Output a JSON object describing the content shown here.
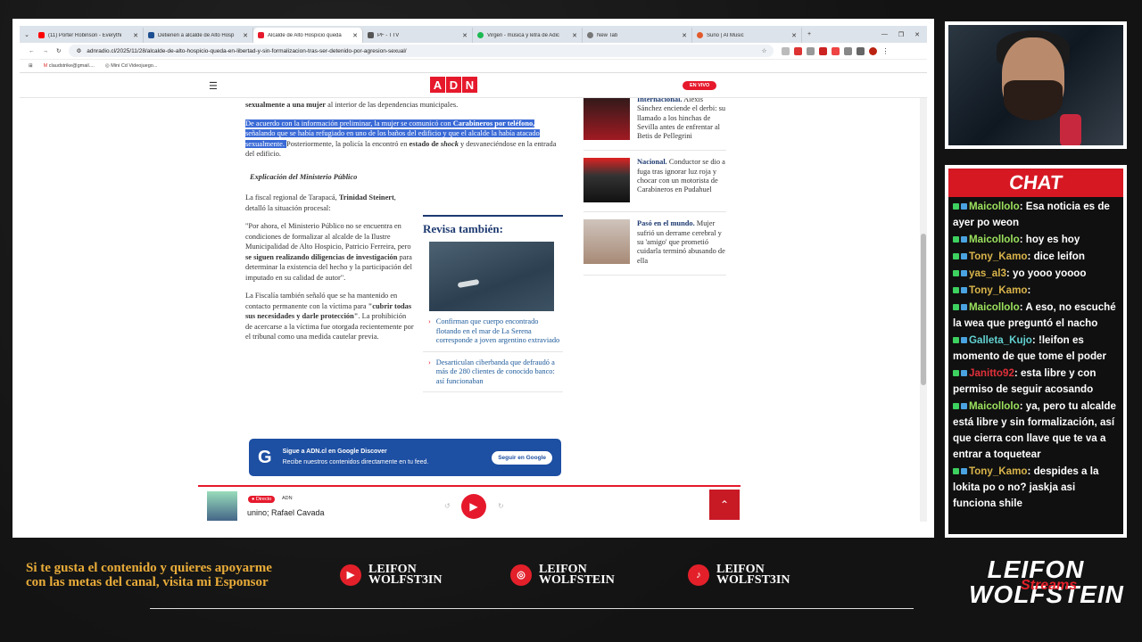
{
  "tabs": [
    {
      "title": "(11) Porter Robinson - Everythi",
      "color": "#ff0000",
      "active": false
    },
    {
      "title": "Detienen a alcalde de Alto Hosp",
      "color": "#1d4f91",
      "active": false
    },
    {
      "title": "Alcalde de Alto Hospicio queda",
      "color": "#e6192c",
      "active": true
    },
    {
      "title": "PF - TTV",
      "color": "#555555",
      "active": false
    },
    {
      "title": "Virgen - música y letra de Adic",
      "color": "#1db954",
      "active": false
    },
    {
      "title": "New Tab",
      "color": "#777777",
      "active": false
    },
    {
      "title": "Suno | AI Music",
      "color": "#e25b2c",
      "active": false
    }
  ],
  "url": "adnradio.cl/2025/11/28/alcalde-de-alto-hospicio-queda-en-libertad-y-sin-formalizacion-tras-ser-detenido-por-agresion-sexual/",
  "bookmarks": [
    "claudstrike@gmail....",
    "Mini Cd Videojuego..."
  ],
  "site": {
    "logo": [
      "A",
      "D",
      "N"
    ],
    "live": "EN VIVO"
  },
  "article": {
    "p0_bold": "sexualmente a una mujer",
    "p0_rest": " al interior de las dependencias municipales.",
    "p1_hl_a": "De acuerdo con la información preliminar, la mujer se comunicó con ",
    "p1_hl_b": "Carabineros por teléfono,",
    "p1_hl_c": " señalando que se había refugiado en uno de los baños del edificio y que el alcalde la había atacado sexualmente. ",
    "p1_rest_a": "Posteriormente, la policía la encontró en ",
    "p1_rest_b": "estado de ",
    "p1_rest_c": "shock",
    "p1_rest_d": " y desvaneciéndose en la entrada del edificio.",
    "subheading": "Explicación del Ministerio Público",
    "p2_a": "La fiscal regional de Tarapacá, ",
    "p2_b": "Trinidad Steinert",
    "p2_c": ", detalló la situación procesal:",
    "p3_a": "\"Por ahora, el Ministerio Público no se encuentra en condiciones de formalizar al alcalde de la Ilustre Municipalidad de Alto Hospicio, Patricio Ferreira, pero ",
    "p3_b": "se siguen realizando diligencias de investigación",
    "p3_c": " para determinar la existencia del hecho y la participación del imputado en su calidad de autor\".",
    "p4_a": "La Fiscalía también señaló que se ha mantenido en contacto permanente con la víctima para ",
    "p4_b": "\"cubrir todas sus necesidades y darle protección\"",
    "p4_c": ". La prohibición de acercarse a la víctima fue otorgada recientemente por el tribunal como una medida cautelar previa."
  },
  "revisa": {
    "title": "Revisa también:",
    "links": [
      "Confirman que cuerpo encontrado flotando en el mar de La Serena corresponde a joven argentino extraviado",
      "Desarticulan ciberbanda que defraudó a más de 280 clientes de conocido banco: así funcionaban"
    ]
  },
  "sidebar_news": [
    {
      "cat": "Internacional.",
      "text": " Alexis Sánchez enciende el derbi: su llamado a los hinchas de Sevilla antes de enfrentar al Betis de Pellegrini"
    },
    {
      "cat": "Nacional.",
      "text": " Conductor se dio a fuga tras ignorar luz roja y chocar con un motorista de Carabineros en Pudahuel"
    },
    {
      "cat": "Pasó en el mundo.",
      "text": " Mujer sufrió un derrame cerebral y su 'amigo' que prometió cuidarla terminó abusando de ella"
    }
  ],
  "gdiscover": {
    "title": "Sigue a ADN.cl en Google Discover",
    "sub": "Recibe nuestros contenidos directamente en tu feed.",
    "button": "Seguir en Google"
  },
  "player": {
    "badge": "Directo",
    "station": "ADN",
    "program": "unino; Rafael Cavada"
  },
  "chat": {
    "title": "CHAT",
    "messages": [
      {
        "user": "Maicollolo",
        "color": "#9be15d",
        "text": ": Esa noticia es de ayer po weon"
      },
      {
        "user": "Maicollolo",
        "color": "#9be15d",
        "text": ": hoy es hoy"
      },
      {
        "user": "Tony_Kamo",
        "color": "#d9b44a",
        "text": ": dice leifon"
      },
      {
        "user": "yas_al3",
        "color": "#d9b44a",
        "text": ": yo yooo yoooo"
      },
      {
        "user": "Tony_Kamo",
        "color": "#d9b44a",
        "text": ":"
      },
      {
        "user": "Maicollolo",
        "color": "#9be15d",
        "text": ": A eso, no escuché la wea que preguntó el nacho"
      },
      {
        "user": "Galleta_Kujo",
        "color": "#62d0d0",
        "text": ": !leifon es momento de que tome el poder"
      },
      {
        "user": "Janitto92",
        "color": "#e0303a",
        "text": ": esta libre y con permiso de seguir acosando"
      },
      {
        "user": "Maicollolo",
        "color": "#9be15d",
        "text": ": ya, pero tu alcalde está libre y sin formalización, así que cierra con llave que te va a entrar a toquetear"
      },
      {
        "user": "Tony_Kamo",
        "color": "#d9b44a",
        "text": ": despides a la lokita po o no? jaskja asi funciona shile"
      }
    ]
  },
  "overlay": {
    "sponsor_text": "Si te gusta el contenido y quieres apoyarme con las metas del canal, visita mi Esponsor",
    "socials": [
      {
        "line1": "LEIFON",
        "line2": "WOLFST3IN",
        "icon": "youtube-icon"
      },
      {
        "line1": "LEIFON",
        "line2": "WOLFSTEIN",
        "icon": "instagram-icon"
      },
      {
        "line1": "LEIFON",
        "line2": "WOLFST3IN",
        "icon": "tiktok-icon"
      }
    ],
    "brand_top": "LEIFON",
    "brand_bottom": "WOLFSTEIN",
    "brand_script": "Streams"
  }
}
